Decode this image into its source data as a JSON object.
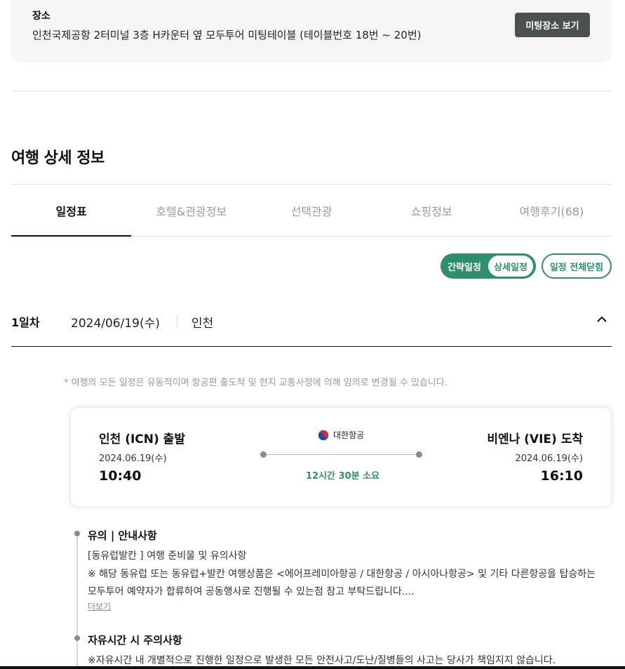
{
  "meeting": {
    "label": "장소",
    "place": "인천국제공항 2터미널 3층 H카운터 옆 모두투어 미팅테이블 (테이블번호 18번 ~ 20번)",
    "button": "미팅장소 보기"
  },
  "section_title": "여행 상세 정보",
  "tabs": [
    {
      "label": "일정표",
      "active": true
    },
    {
      "label": "호텔&관광정보",
      "active": false
    },
    {
      "label": "선택관광",
      "active": false
    },
    {
      "label": "쇼핑정보",
      "active": false
    },
    {
      "label": "여행후기(68)",
      "active": false
    }
  ],
  "view_toggle": {
    "simple": "간략일정",
    "detail": "상세일정",
    "collapse_all": "일정 전체닫힘"
  },
  "day": {
    "num": "1일차",
    "date": "2024/06/19(수)",
    "city": "인천"
  },
  "notice": "* 여행의 모든 일정은 유동적이며 항공편 출도착 및 현지 교통사정에 의해 임의로 변경될 수 있습니다.",
  "flight": {
    "departure": {
      "title": "인천 (ICN) 출발",
      "date": "2024.06.19(수)",
      "time": "10:40"
    },
    "arrival": {
      "title": "비엔나 (VIE) 도착",
      "date": "2024.06.19(수)",
      "time": "16:10"
    },
    "airline": "대한항공",
    "duration": "12시간 30분 소요"
  },
  "notes": {
    "title": "유의  |  안내사항",
    "line1": "[동유럽발칸 ] 여행 준비물 및 유의사항",
    "line2": "※ 해당 동유럽 또는 동유럽+발칸 여행상품은 <에어프레미아항공 / 대한항공 / 아시아나항공> 및 기타 다른항공을 탑승하는",
    "line3": "모두투어 예약자가 합류하여 공동행사로 진행될 수 있는점 참고 부탁드립니다....",
    "more": "더보기"
  },
  "free_time": {
    "title": "자유시간 시 주의사항",
    "line1": "※자유시간 내 개별적으로 진행한 일정으로 발생한 모든 안전사고/도난/질병들의 사고는 당사가 책임지지 않습니다."
  },
  "colors": {
    "accent": "#2f8f6c",
    "dark_button": "#4a514f"
  }
}
